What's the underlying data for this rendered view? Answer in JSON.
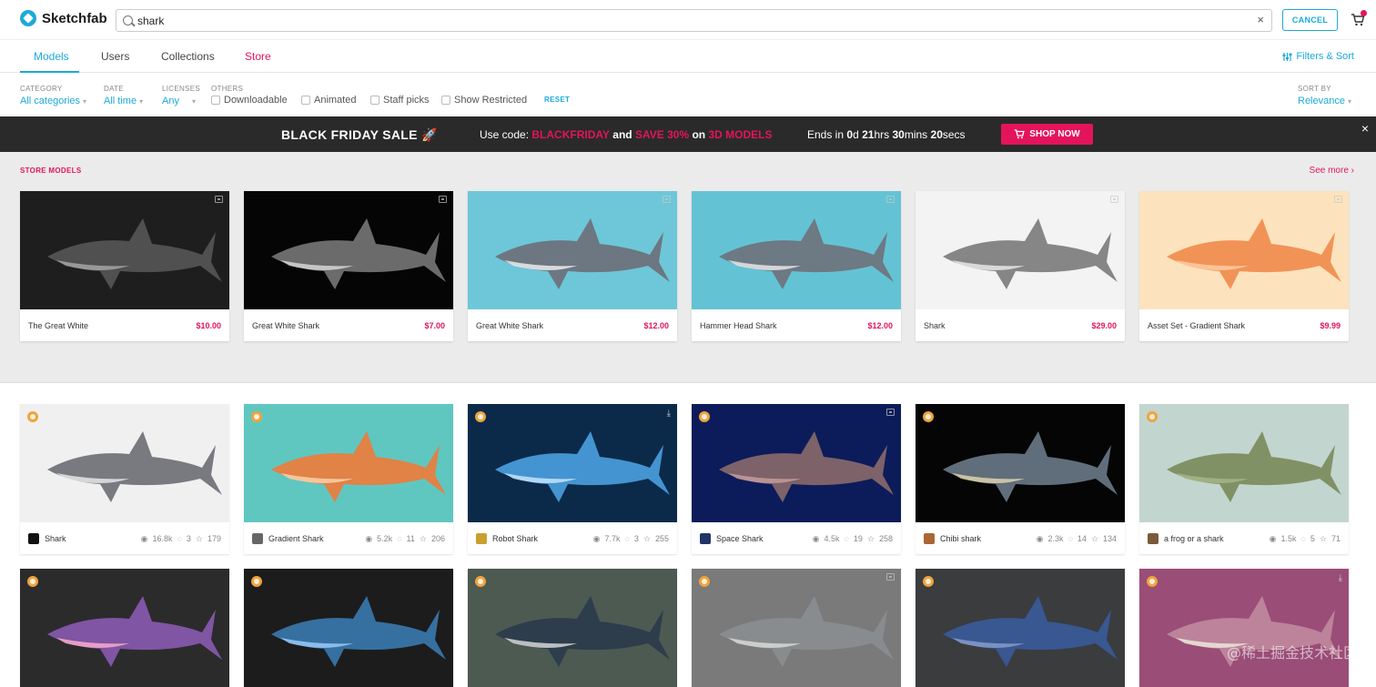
{
  "app": {
    "name": "Sketchfab"
  },
  "search": {
    "value": "shark",
    "clear": "×",
    "cancel_label": "CANCEL"
  },
  "tabs": [
    {
      "label": "Models"
    },
    {
      "label": "Users"
    },
    {
      "label": "Collections"
    },
    {
      "label": "Store"
    }
  ],
  "filters_sort_label": "Filters & Sort",
  "filters": {
    "category": {
      "label": "CATEGORY",
      "value": "All categories"
    },
    "date": {
      "label": "DATE",
      "value": "All time"
    },
    "licenses": {
      "label": "LICENSES",
      "value": "Any"
    },
    "others": {
      "label": "OTHERS"
    },
    "checks": [
      "Downloadable",
      "Animated",
      "Staff picks",
      "Show Restricted"
    ],
    "reset": "RESET",
    "sort": {
      "label": "SORT BY",
      "value": "Relevance"
    }
  },
  "banner": {
    "title": "BLACK FRIDAY SALE",
    "emoji": "🚀",
    "code_prefix": "Use code:",
    "code": "BLACKFRIDAY",
    "and": "and",
    "save": "SAVE 30%",
    "on": "on",
    "models": "3D MODELS",
    "ends_prefix": "Ends in",
    "days": "0",
    "days_unit": "d",
    "hours": "21",
    "hours_unit": "hrs",
    "mins": "30",
    "mins_unit": "mins",
    "secs": "20",
    "secs_unit": "secs",
    "shop_label": "SHOP NOW",
    "close": "×"
  },
  "store": {
    "title": "STORE MODELS",
    "see_more": "See more ›",
    "items": [
      {
        "title": "The Great White",
        "price": "$10.00",
        "bg": "#1e1e1e"
      },
      {
        "title": "Great White Shark",
        "price": "$7.00",
        "bg": "#050505"
      },
      {
        "title": "Great White Shark",
        "price": "$12.00",
        "bg": "#6dc7d8"
      },
      {
        "title": "Hammer Head Shark",
        "price": "$12.00",
        "bg": "#63c3d4"
      },
      {
        "title": "Shark",
        "price": "$29.00",
        "bg": "#f3f3f3"
      },
      {
        "title": "Asset Set - Gradient Shark",
        "price": "$9.99",
        "bg": "#fde3bd"
      }
    ]
  },
  "models": [
    {
      "title": "Shark",
      "views": "16.8k",
      "comments": "3",
      "likes": "179",
      "bg": "#f0f0f0",
      "avatar": "#111"
    },
    {
      "title": "Gradient Shark",
      "views": "5.2k",
      "comments": "11",
      "likes": "206",
      "bg": "#5fc7c0",
      "avatar": "#666"
    },
    {
      "title": "Robot Shark",
      "views": "7.7k",
      "comments": "3",
      "likes": "255",
      "bg": "#0b2a4a",
      "avatar": "#c8a030"
    },
    {
      "title": "Space Shark",
      "views": "4.5k",
      "comments": "19",
      "likes": "258",
      "bg": "#0c1c5a",
      "avatar": "#223366"
    },
    {
      "title": "Chibi shark",
      "views": "2.3k",
      "comments": "14",
      "likes": "134",
      "bg": "#050505",
      "avatar": "#aa6633"
    },
    {
      "title": "a frog or a shark",
      "views": "1.5k",
      "comments": "5",
      "likes": "71",
      "bg": "#c3d5cf",
      "avatar": "#7a5a3a"
    },
    {
      "bg": "#2b2b2b"
    },
    {
      "bg": "#1c1c1c"
    },
    {
      "bg": "#4c5a52"
    },
    {
      "bg": "#7a7a7a"
    },
    {
      "bg": "#3a3c3e"
    },
    {
      "bg": "#9a4d76"
    }
  ],
  "watermark": "@稀土掘金技术社区"
}
